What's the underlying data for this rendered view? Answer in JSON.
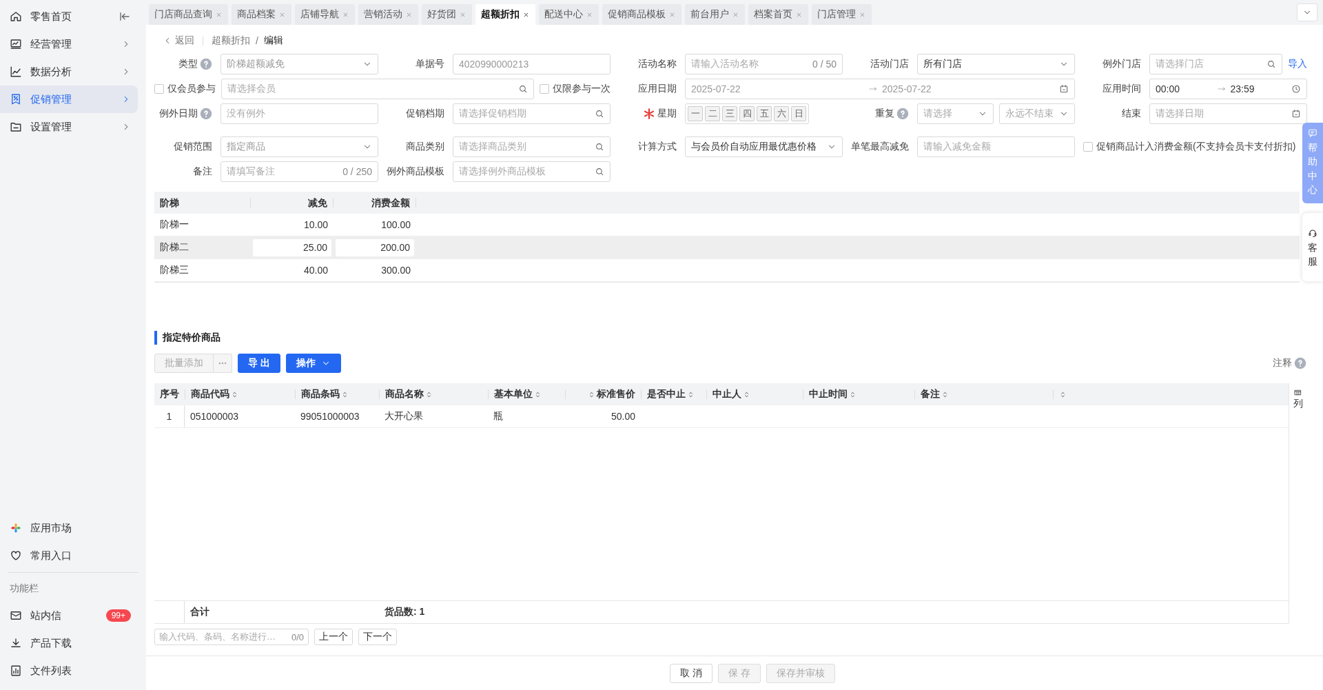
{
  "sidebar": {
    "items": [
      {
        "label": "零售首页",
        "selected": false,
        "kind": "collapse"
      },
      {
        "label": "经营管理",
        "selected": false,
        "kind": "menu"
      },
      {
        "label": "数据分析",
        "selected": false,
        "kind": "menu"
      },
      {
        "label": "促销管理",
        "selected": true,
        "kind": "menu"
      },
      {
        "label": "设置管理",
        "selected": false,
        "kind": "menu"
      }
    ],
    "bottom_items": [
      {
        "label": "应用市场"
      },
      {
        "label": "常用入口"
      }
    ],
    "section_label": "功能栏",
    "tool_items": [
      {
        "label": "站内信",
        "badge": "99+"
      },
      {
        "label": "产品下载"
      },
      {
        "label": "文件列表"
      }
    ]
  },
  "tabs": [
    {
      "label": "门店商品查询",
      "selected": false
    },
    {
      "label": "商品档案",
      "selected": false
    },
    {
      "label": "店铺导航",
      "selected": false
    },
    {
      "label": "营销活动",
      "selected": false
    },
    {
      "label": "好货团",
      "selected": false
    },
    {
      "label": "超额折扣",
      "selected": true
    },
    {
      "label": "配送中心",
      "selected": false
    },
    {
      "label": "促销商品模板",
      "selected": false
    },
    {
      "label": "前台用户",
      "selected": false
    },
    {
      "label": "档案首页",
      "selected": false
    },
    {
      "label": "门店管理",
      "selected": false
    }
  ],
  "breadcrumb": {
    "back": "返回",
    "path": [
      "超额折扣",
      "编辑"
    ],
    "separator": "/"
  },
  "form": {
    "rows": [
      {
        "fields": [
          {
            "kind": "select",
            "label": "类型",
            "help": true,
            "value": "阶梯超额减免",
            "disabled": true
          },
          {
            "kind": "input",
            "label": "单据号",
            "value": "4020990000213",
            "disabled": true
          },
          {
            "kind": "input",
            "label": "活动名称",
            "placeholder": "请输入活动名称",
            "counter": "0 / 50"
          },
          {
            "kind": "select",
            "label": "活动门店",
            "value": "所有门店",
            "disabled": false
          },
          {
            "kind": "search",
            "label": "例外门店",
            "placeholder": "请选择门店",
            "link": "导入"
          }
        ]
      },
      {
        "fields": [
          {
            "kind": "check_search",
            "check": {
              "label": "仅会员参与",
              "checked": false
            },
            "placeholder": "请选择会员",
            "extra_check": {
              "label": "仅限参与一次",
              "checked": false
            }
          },
          {
            "kind": "date_range",
            "label": "应用日期",
            "start": "2025-07-22",
            "end": "2025-07-22"
          },
          {
            "kind": "time_range",
            "label": "应用时间",
            "start": "00:00",
            "end": "23:59"
          }
        ]
      },
      {
        "fields": [
          {
            "kind": "input",
            "label": "例外日期",
            "help": true,
            "placeholder": "没有例外"
          },
          {
            "kind": "search",
            "label": "促销档期",
            "placeholder": "请选择促销档期"
          },
          {
            "kind": "weekdays",
            "label": "星期",
            "required": true,
            "days": [
              "一",
              "二",
              "三",
              "四",
              "五",
              "六",
              "日"
            ]
          },
          {
            "kind": "double_select",
            "label": "重复",
            "help": true,
            "placeholders": [
              "请选择",
              "永远不结束"
            ]
          },
          {
            "kind": "date",
            "label": "结束",
            "placeholder": "请选择日期"
          }
        ]
      },
      {
        "fields": [
          {
            "kind": "select",
            "label": "促销范围",
            "value": "指定商品",
            "disabled": true
          },
          {
            "kind": "search",
            "label": "商品类别",
            "placeholder": "请选择商品类别"
          },
          {
            "kind": "select",
            "label": "计算方式",
            "value": "与会员价自动应用最优惠价格",
            "disabled": false
          },
          {
            "kind": "input",
            "label": "单笔最高减免",
            "placeholder": "请输入减免金额"
          },
          {
            "kind": "checkbox",
            "label": "促销商品计入消费金额(不支持会员卡支付折扣)",
            "checked": false
          }
        ]
      },
      {
        "fields": [
          {
            "kind": "input",
            "label": "备注",
            "placeholder": "请填写备注",
            "counter": "0 / 250"
          },
          {
            "kind": "search",
            "label": "例外商品模板",
            "placeholder": "请选择例外商品模板"
          }
        ]
      }
    ]
  },
  "ladder": {
    "columns": [
      "阶梯",
      "减免",
      "消费金额"
    ],
    "rows": [
      {
        "cells": [
          "阶梯一",
          "10.00",
          "100.00"
        ],
        "editing": false
      },
      {
        "cells": [
          "阶梯二",
          "25.00",
          "200.00"
        ],
        "editing": true
      },
      {
        "cells": [
          "阶梯三",
          "40.00",
          "300.00"
        ],
        "editing": false
      }
    ]
  },
  "goods": {
    "title": "指定特价商品",
    "toolbar": [
      {
        "kind": "split",
        "label": "批量添加",
        "disabled": true
      },
      {
        "kind": "primary",
        "label": "导 出"
      },
      {
        "kind": "dropdown",
        "label": "操作"
      }
    ],
    "note": "注释",
    "columns": [
      {
        "label": "序号",
        "sortable": false
      },
      {
        "label": "商品代码",
        "sortable": true
      },
      {
        "label": "商品条码",
        "sortable": true
      },
      {
        "label": "商品名称",
        "sortable": true
      },
      {
        "label": "基本单位",
        "sortable": true
      },
      {
        "label": "标准售价",
        "sortable": true
      },
      {
        "label": "是否中止",
        "sortable": true
      },
      {
        "label": "中止人",
        "sortable": true
      },
      {
        "label": "中止时间",
        "sortable": true
      },
      {
        "label": "备注",
        "sortable": true
      },
      {
        "sortable": true
      }
    ],
    "rows": [
      {
        "cells": [
          "1",
          "051000003",
          "99051000003",
          "大开心果",
          "瓶",
          "50.00"
        ]
      }
    ],
    "footer": {
      "label": "合计",
      "count": "货品数: 1"
    },
    "column_settings": "列"
  },
  "pager": {
    "placeholder": "输入代码、条码、名称进行…",
    "counter": "0/0",
    "buttons": [
      "上一个",
      "下一个"
    ]
  },
  "actions": [
    {
      "label": "取 消",
      "disabled": false
    },
    {
      "label": "保 存",
      "disabled": true
    },
    {
      "label": "保存并审核",
      "disabled": true
    }
  ],
  "floating": [
    {
      "kind": "help",
      "label": "帮助中心"
    },
    {
      "kind": "service",
      "label": "客服"
    }
  ]
}
